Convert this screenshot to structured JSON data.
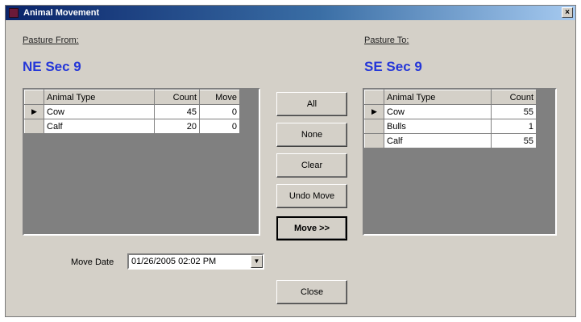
{
  "window": {
    "title": "Animal Movement",
    "close_label": "×"
  },
  "from": {
    "label": "Pasture From:",
    "name": "NE Sec 9",
    "columns": [
      "Animal Type",
      "Count",
      "Move"
    ],
    "rows": [
      {
        "selector": "▶",
        "animal_type": "Cow",
        "count": "45",
        "move": "0"
      },
      {
        "selector": "",
        "animal_type": "Calf",
        "count": "20",
        "move": "0"
      }
    ]
  },
  "to": {
    "label": "Pasture To:",
    "name": "SE Sec 9",
    "columns": [
      "Animal Type",
      "Count"
    ],
    "rows": [
      {
        "selector": "▶",
        "animal_type": "Cow",
        "count": "55"
      },
      {
        "selector": "",
        "animal_type": "Bulls",
        "count": "1"
      },
      {
        "selector": "",
        "animal_type": "Calf",
        "count": "55"
      }
    ]
  },
  "buttons": {
    "all": "All",
    "none": "None",
    "clear": "Clear",
    "undo_move": "Undo Move",
    "move": "Move >>",
    "close": "Close"
  },
  "move_date": {
    "label": "Move Date",
    "value": "01/26/2005 02:02 PM",
    "dropdown_glyph": "▼"
  },
  "colors": {
    "title_bar": "#0a246a",
    "pasture_name": "#2436d8",
    "dialog_face": "#d4d0c8"
  }
}
